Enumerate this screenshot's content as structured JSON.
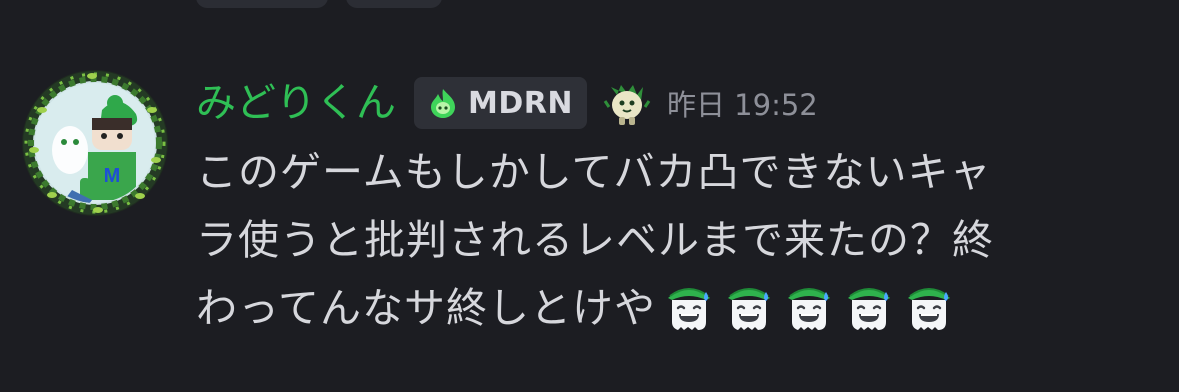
{
  "message": {
    "username": "みどりくん",
    "tag": {
      "icon": "green-flame-icon",
      "label": "MDRN"
    },
    "decoration": "green-creature-badge-icon",
    "timestamp": "昨日 19:52",
    "lines": [
      "このゲームもしかしてバカ凸できないキャ",
      "ラ使うと批判されるレベルまで来たの？終",
      "わってんなサ終しとけや"
    ],
    "emojis": [
      "laughing-sweat-ghost-emoji",
      "laughing-sweat-ghost-emoji",
      "laughing-sweat-ghost-emoji",
      "laughing-sweat-ghost-emoji",
      "laughing-sweat-ghost-emoji"
    ]
  },
  "colors": {
    "background": "#1c1d22",
    "username": "#2fbf55",
    "text": "#d6d7dc",
    "timestamp": "#8e9099",
    "tag_bg": "#2e3037"
  }
}
